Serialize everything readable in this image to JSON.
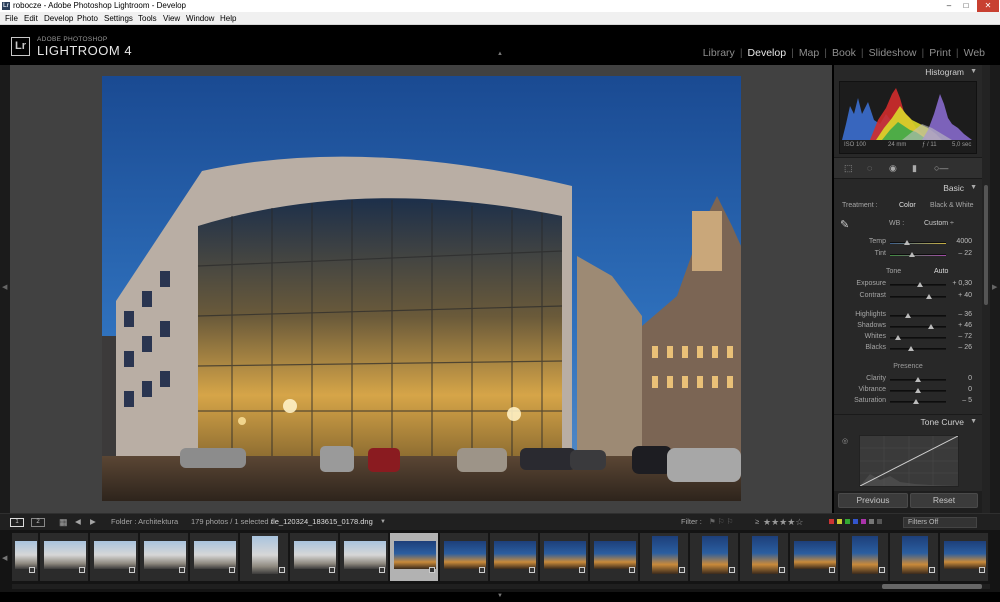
{
  "window": {
    "title": "robocze - Adobe Photoshop Lightroom - Develop",
    "app_icon": "Lr",
    "controls": [
      "–",
      "□",
      "✕"
    ]
  },
  "menubar": {
    "items": [
      "File",
      "Edit",
      "Develop",
      "Photo",
      "Settings",
      "Tools",
      "View",
      "Window",
      "Help"
    ]
  },
  "header": {
    "logo_mark": "Lr",
    "logo_sub": "ADOBE PHOTOSHOP",
    "logo_main": "LIGHTROOM 4",
    "modules": [
      "Library",
      "Develop",
      "Map",
      "Book",
      "Slideshow",
      "Print",
      "Web"
    ],
    "active_module": "Develop"
  },
  "histogram": {
    "title": "Histogram",
    "iso": "ISO 100",
    "focal": "24 mm",
    "aperture": "ƒ / 11",
    "shutter": "5,0 sec"
  },
  "basic": {
    "title": "Basic",
    "treatment_label": "Treatment :",
    "treatment_color": "Color",
    "treatment_bw": "Black & White",
    "wb_label": "WB :",
    "wb_value": "Custom ÷",
    "temp": {
      "label": "Temp",
      "value": "4000",
      "pos": 0.3
    },
    "tint": {
      "label": "Tint",
      "value": "– 22",
      "pos": 0.4
    },
    "tone_label": "Tone",
    "auto_label": "Auto",
    "exposure": {
      "label": "Exposure",
      "value": "+ 0,30",
      "pos": 0.53
    },
    "contrast": {
      "label": "Contrast",
      "value": "+ 40",
      "pos": 0.7
    },
    "highlights": {
      "label": "Highlights",
      "value": "– 36",
      "pos": 0.32
    },
    "shadows": {
      "label": "Shadows",
      "value": "+ 46",
      "pos": 0.73
    },
    "whites": {
      "label": "Whites",
      "value": "– 72",
      "pos": 0.14
    },
    "blacks": {
      "label": "Blacks",
      "value": "– 26",
      "pos": 0.37
    },
    "presence_label": "Presence",
    "clarity": {
      "label": "Clarity",
      "value": "0",
      "pos": 0.5
    },
    "vibrance": {
      "label": "Vibrance",
      "value": "0",
      "pos": 0.5
    },
    "saturation": {
      "label": "Saturation",
      "value": "– 5",
      "pos": 0.47
    }
  },
  "tone_curve": {
    "title": "Tone Curve"
  },
  "buttons": {
    "previous": "Previous",
    "reset": "Reset"
  },
  "filmbar": {
    "screen1": "1",
    "screen2": "2",
    "folder": "Folder : Architektura",
    "count": "179 photos / 1 selected /",
    "filename": "tle_120324_183615_0178.dng",
    "filter_label": "Filter :",
    "rating_op": "≥",
    "stars": 4,
    "filters_off": "Filters Off"
  },
  "colors": {
    "accent_sky": "#1a4f9a",
    "panel_bg": "#282828",
    "canvas_bg": "#414141"
  }
}
